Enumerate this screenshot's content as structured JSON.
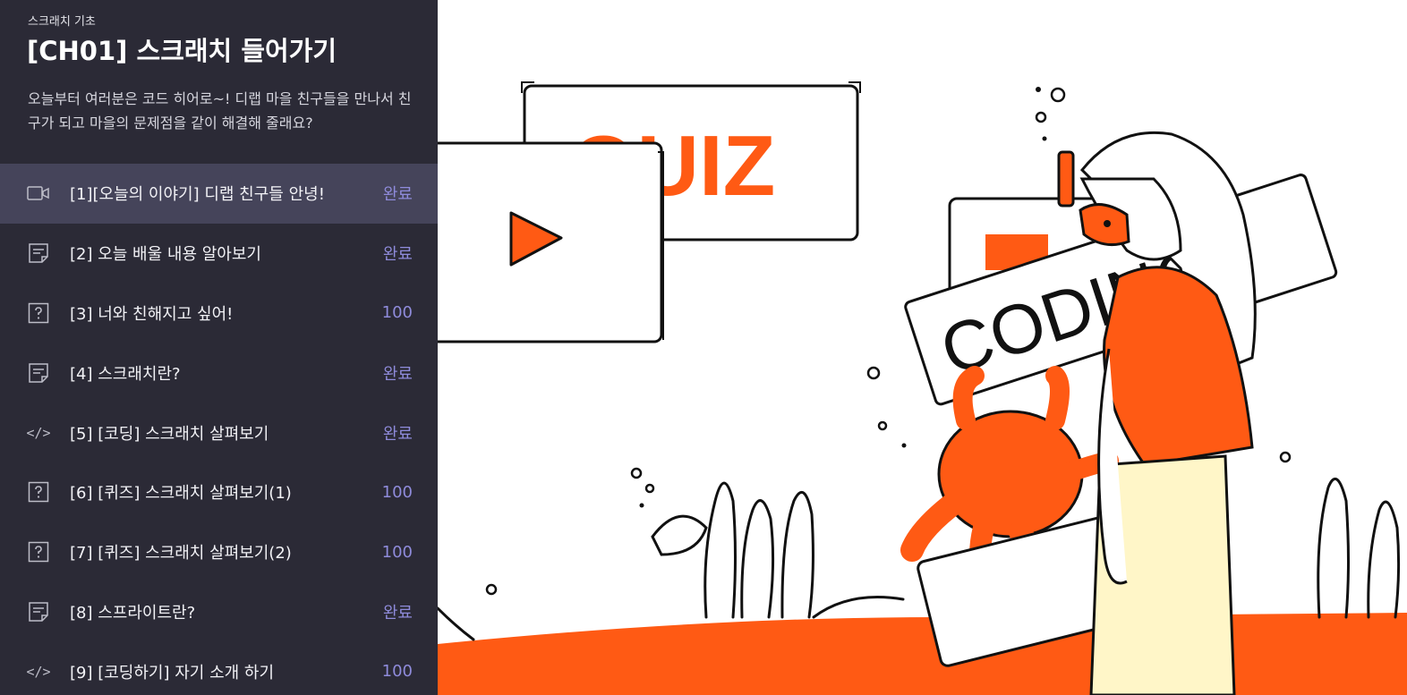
{
  "course": {
    "subtitle": "스크래치 기초",
    "title": "[CH01] 스크래치 들어가기",
    "description": "오늘부터 여러분은 코드 히어로~! 디랩 마을 친구들을 만나서 친구가 되고 마을의 문제점을 같이 해결해 줄래요?"
  },
  "lessons": [
    {
      "icon": "video-icon",
      "label": "[1][오늘의 이야기] 디랩 친구들 안녕!",
      "status": "완료",
      "active": true
    },
    {
      "icon": "note-icon",
      "label": "[2] 오늘 배울 내용 알아보기",
      "status": "완료"
    },
    {
      "icon": "quiz-icon",
      "label": "[3] 너와 친해지고 싶어!",
      "status": "100"
    },
    {
      "icon": "note-icon",
      "label": "[4] 스크래치란?",
      "status": "완료"
    },
    {
      "icon": "code-icon",
      "label": "[5] [코딩] 스크래치 살펴보기",
      "status": "완료"
    },
    {
      "icon": "quiz-icon",
      "label": "[6] [퀴즈] 스크래치 살펴보기(1)",
      "status": "100"
    },
    {
      "icon": "quiz-icon",
      "label": "[7] [퀴즈] 스크래치 살펴보기(2)",
      "status": "100"
    },
    {
      "icon": "note-icon",
      "label": "[8] 스프라이트란?",
      "status": "완료"
    },
    {
      "icon": "code-icon",
      "label": "[9] [코딩하기] 자기 소개 하기",
      "status": "100"
    }
  ],
  "illustration": {
    "quiz_text": "QUIZ",
    "coding_text": "CODING"
  },
  "colors": {
    "sidebar_bg": "#2b2a36",
    "active_row_bg": "#45445a",
    "status_color": "#8f8bdb",
    "accent_orange": "#ff5a14"
  }
}
